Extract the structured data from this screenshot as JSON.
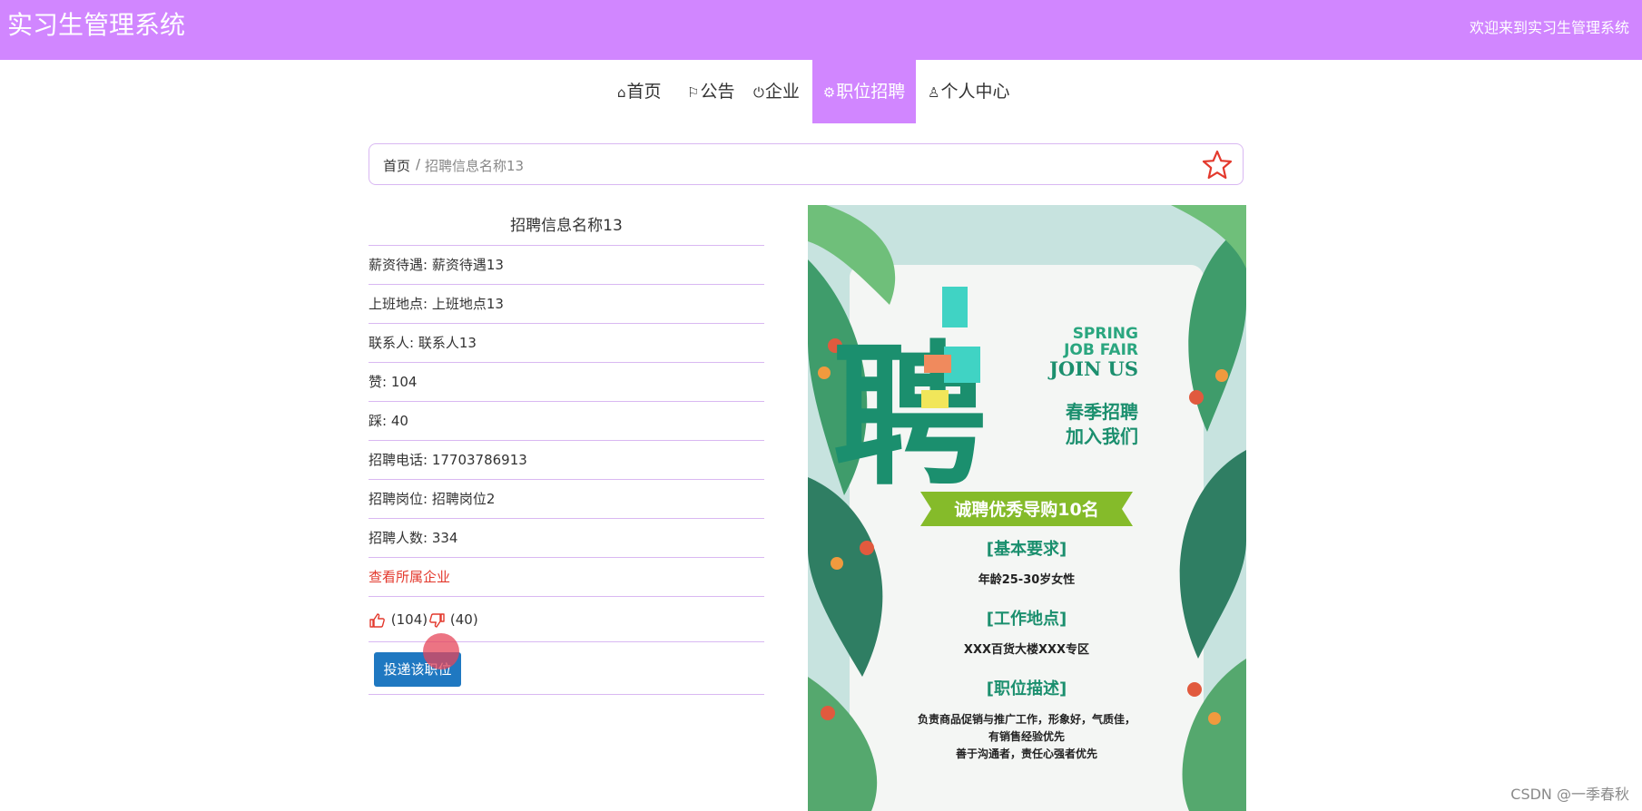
{
  "header": {
    "title": "实习生管理系统",
    "welcome": "欢迎来到实习生管理系统",
    "color": "#d186ff"
  },
  "nav": {
    "items": [
      {
        "label": "首页",
        "icon": "home-icon"
      },
      {
        "label": "公告",
        "icon": "flag-icon"
      },
      {
        "label": "企业",
        "icon": "power-icon"
      },
      {
        "label": "职位招聘",
        "icon": "settings-icon",
        "active": true
      },
      {
        "label": "个人中心",
        "icon": "user-icon"
      }
    ]
  },
  "breadcrumb": {
    "home": "首页",
    "sep": "/",
    "current": "招聘信息名称13"
  },
  "detail": {
    "title": "招聘信息名称13",
    "rows": [
      "薪资待遇: 薪资待遇13",
      "上班地点: 上班地点13",
      "联系人: 联系人13",
      "赞: 104",
      "踩: 40",
      "招聘电话: 17703786913",
      "招聘岗位: 招聘岗位2",
      "招聘人数: 334"
    ],
    "company_link": "查看所属企业",
    "likes": "(104)",
    "dislikes": "(40)",
    "apply_button": "投递该职位"
  },
  "poster": {
    "spring": "SPRING",
    "job_fair": "JOB FAIR",
    "join_us": "JOIN US",
    "big_char": "聘",
    "cn_line1": "春季招聘",
    "cn_line2": "加入我们",
    "banner": "诚聘优秀导购10名",
    "req_title": "[基本要求]",
    "req_text": "年龄25-30岁女性",
    "loc_title": "[工作地点]",
    "loc_text": "XXX百货大楼XXX专区",
    "desc_title": "[职位描述]",
    "desc_line1": "负责商品促销与推广工作，形象好，气质佳，",
    "desc_line2": "有销售经验优先",
    "desc_line3": "善于沟通者，责任心强者优先"
  },
  "watermark": "CSDN @一季春秋"
}
